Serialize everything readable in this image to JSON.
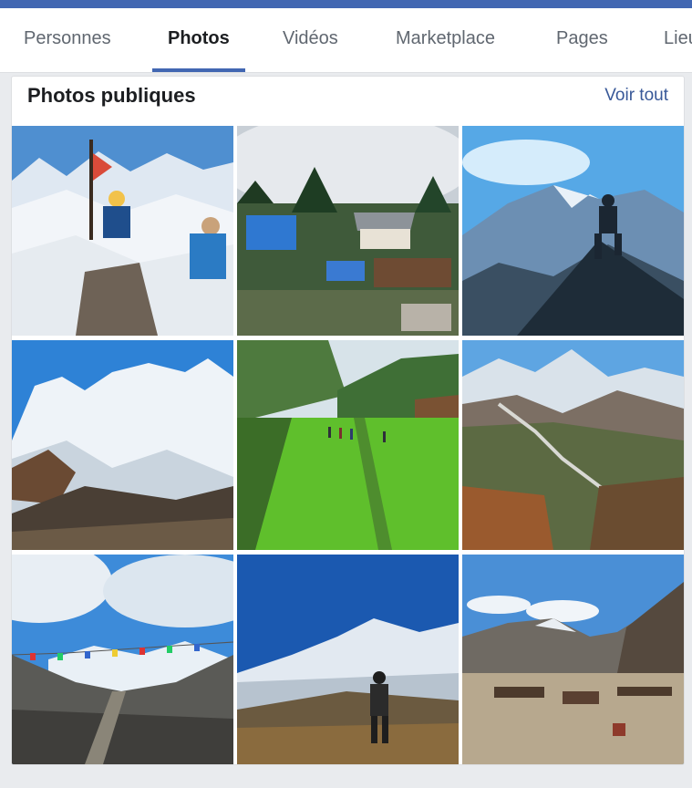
{
  "tabs": {
    "items": [
      {
        "label": "Personnes"
      },
      {
        "label": "Photos",
        "active": true
      },
      {
        "label": "Vidéos"
      },
      {
        "label": "Marketplace"
      },
      {
        "label": "Pages"
      },
      {
        "label": "Lieu"
      }
    ]
  },
  "section": {
    "title": "Photos publiques",
    "see_all_label": "Voir tout"
  },
  "colors": {
    "brand_blue": "#4267b2",
    "link_blue": "#385898"
  }
}
